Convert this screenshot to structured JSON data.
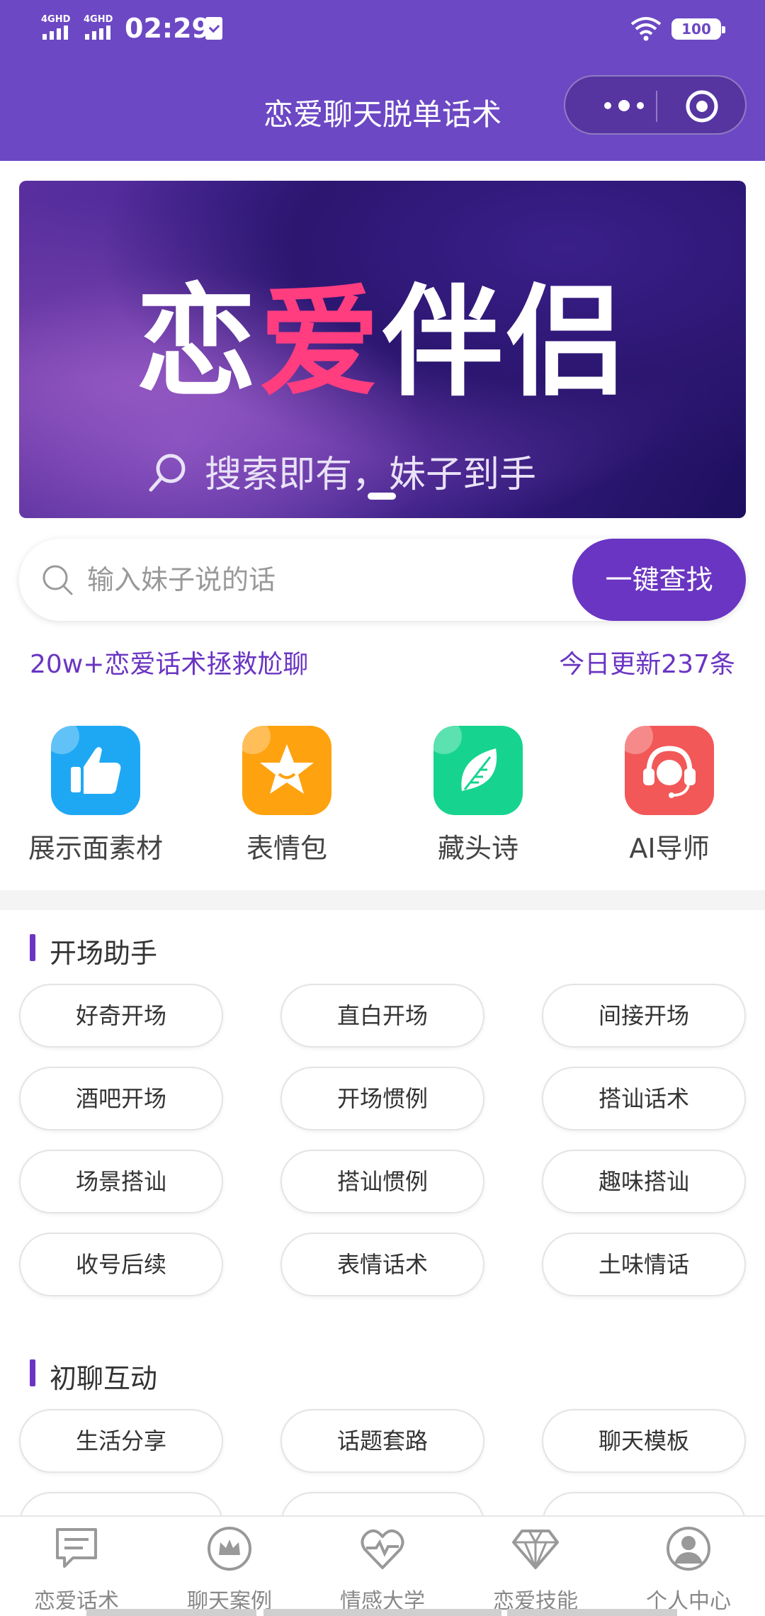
{
  "status_bar": {
    "network_1": "4GHD",
    "network_2": "4GHD",
    "time": "02:29",
    "battery": "100"
  },
  "header": {
    "title": "恋爱聊天脱单话术"
  },
  "banner": {
    "title_part1": "恋",
    "title_heart": "爱",
    "title_part2": "伴侣",
    "tagline": "搜索即有，妹子到手"
  },
  "search": {
    "placeholder": "输入妹子说的话",
    "button_label": "一键查找"
  },
  "stats": {
    "left": "20w+恋爱话术拯救尬聊",
    "right": "今日更新237条"
  },
  "quick_actions": [
    {
      "label": "展示面素材",
      "icon": "thumbs-up-icon",
      "color": "#1ea8f4"
    },
    {
      "label": "表情包",
      "icon": "star-icon",
      "color": "#ffa20f"
    },
    {
      "label": "藏头诗",
      "icon": "leaf-icon",
      "color": "#16d48f"
    },
    {
      "label": "AI导师",
      "icon": "headset-icon",
      "color": "#f25858"
    }
  ],
  "sections": [
    {
      "title": "开场助手",
      "chips": [
        "好奇开场",
        "直白开场",
        "间接开场",
        "酒吧开场",
        "开场惯例",
        "搭讪话术",
        "场景搭讪",
        "搭讪惯例",
        "趣味搭讪",
        "收号后续",
        "表情话术",
        "土味情话"
      ]
    },
    {
      "title": "初聊互动",
      "chips": [
        "生活分享",
        "话题套路",
        "聊天模板"
      ]
    }
  ],
  "bottom_nav": [
    {
      "label": "恋爱话术",
      "icon": "chat-icon"
    },
    {
      "label": "聊天案例",
      "icon": "crown-icon"
    },
    {
      "label": "情感大学",
      "icon": "heart-pulse-icon"
    },
    {
      "label": "恋爱技能",
      "icon": "diamond-icon"
    },
    {
      "label": "个人中心",
      "icon": "user-icon"
    }
  ],
  "colors": {
    "header_bg": "#6c48c4",
    "accent": "#6a35c2"
  }
}
